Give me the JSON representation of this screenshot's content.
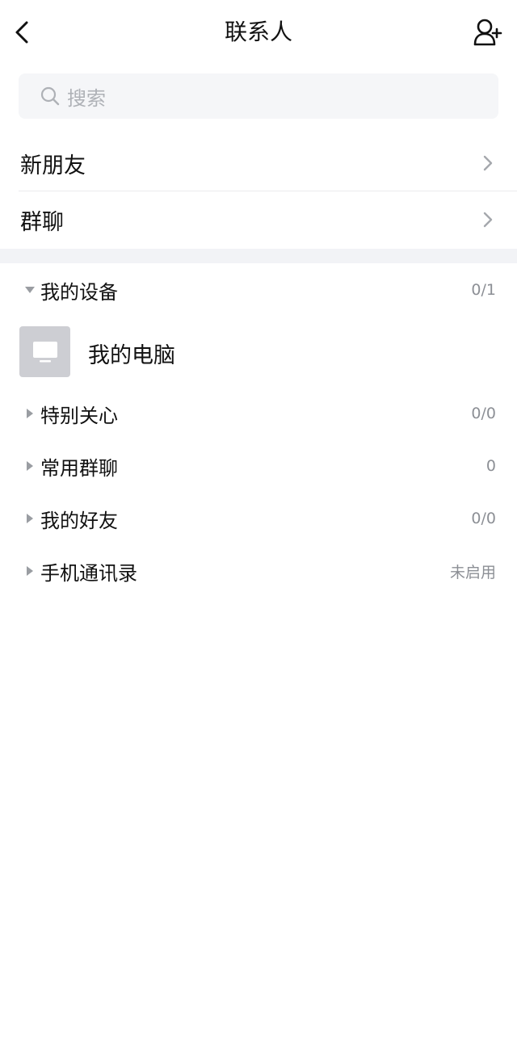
{
  "header": {
    "title": "联系人",
    "back_icon": "chevron-left-icon",
    "add_icon": "add-contact-icon"
  },
  "search": {
    "placeholder": "搜索",
    "icon": "search-icon"
  },
  "nav_items": [
    {
      "label": "新朋友",
      "icon": "chevron-right-icon"
    },
    {
      "label": "群聊",
      "icon": "chevron-right-icon"
    }
  ],
  "groups": [
    {
      "label": "我的设备",
      "count": "0/1",
      "expanded": true,
      "items": [
        {
          "name": "我的电脑",
          "icon": "computer-icon"
        }
      ]
    },
    {
      "label": "特别关心",
      "count": "0/0",
      "expanded": false
    },
    {
      "label": "常用群聊",
      "count": "0",
      "expanded": false
    },
    {
      "label": "我的好友",
      "count": "0/0",
      "expanded": false
    },
    {
      "label": "手机通讯录",
      "count": "未启用",
      "expanded": false
    }
  ],
  "colors": {
    "background": "#ffffff",
    "search_bg": "#f5f6f8",
    "section_gap": "#f2f3f6",
    "primary_text": "#111111",
    "secondary_text": "#8c8f95",
    "avatar_bg": "#cdced3"
  }
}
